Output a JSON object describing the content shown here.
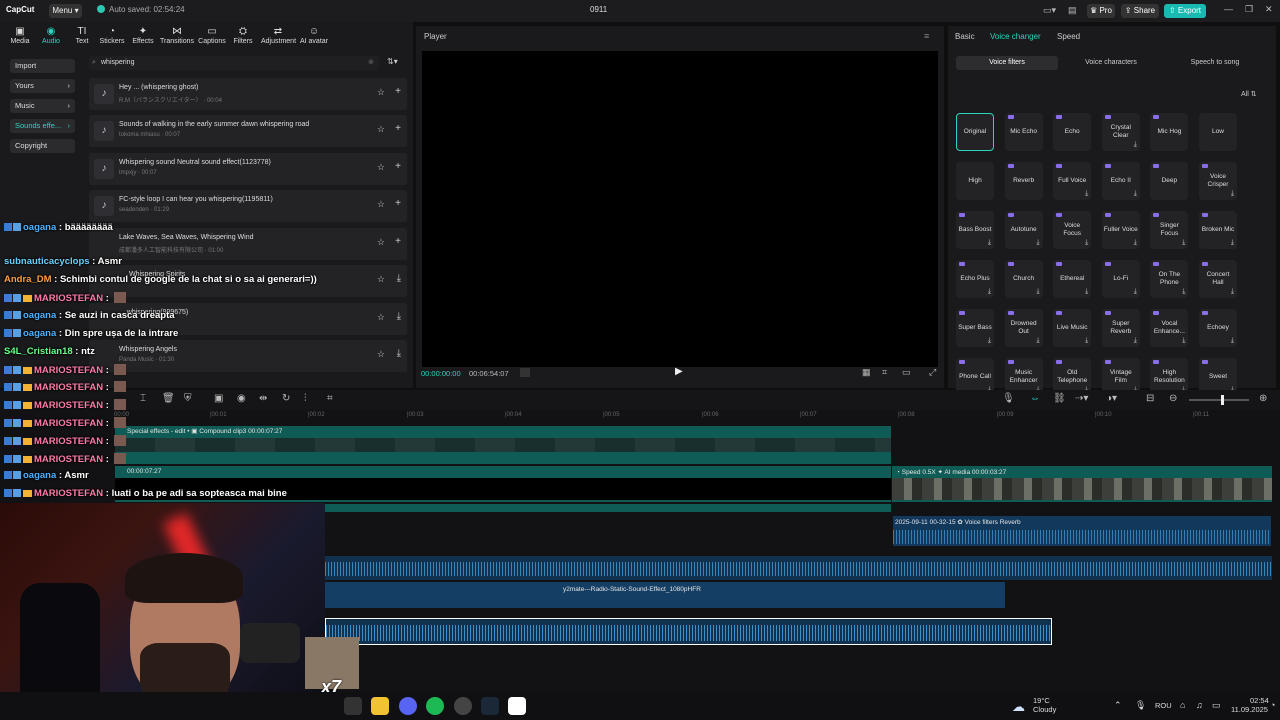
{
  "titlebar": {
    "logo": "CapCut",
    "menu": "Menu",
    "autosave": "Auto saved: 02:54:24",
    "project": "0911",
    "pro": "Pro",
    "share": "Share",
    "export": "Export"
  },
  "toolbar": {
    "items": [
      {
        "label": "Media",
        "icon": "media-icon"
      },
      {
        "label": "Audio",
        "icon": "audio-icon"
      },
      {
        "label": "Text",
        "icon": "text-icon"
      },
      {
        "label": "Stickers",
        "icon": "stickers-icon"
      },
      {
        "label": "Effects",
        "icon": "effects-icon"
      },
      {
        "label": "Transitions",
        "icon": "transitions-icon"
      },
      {
        "label": "Captions",
        "icon": "captions-icon"
      },
      {
        "label": "Filters",
        "icon": "filters-icon"
      },
      {
        "label": "Adjustment",
        "icon": "adjustment-icon"
      },
      {
        "label": "AI avatar",
        "icon": "ai-avatar-icon"
      }
    ]
  },
  "leftnav": {
    "import": "Import",
    "yours": "Yours",
    "music": "Music",
    "sounds": "Sounds effe...",
    "copyright": "Copyright"
  },
  "search": {
    "value": "whispering"
  },
  "tracks": [
    {
      "title": "Hey ... (whispering ghost)",
      "sub": "R.M（バランスクリエイター） · 00:04"
    },
    {
      "title": "Sounds of walking in the early summer dawn whispering road",
      "sub": "tokoma mhiasu · 00:07"
    },
    {
      "title": "Whispering sound Neutral sound effect(1123778)",
      "sub": "tmpxjy · 00:07"
    },
    {
      "title": "FC-style loop I can hear you whispering(1195811)",
      "sub": "seadenden · 01:29"
    },
    {
      "title": "Lake Waves, Sea Waves, Whispering Wind",
      "sub": "成都潘多人工智能科技有限公司 · 01:00"
    },
    {
      "title": "Whispering Spirits",
      "sub": ""
    },
    {
      "title": "... whispering(999675)",
      "sub": ""
    },
    {
      "title": "Whispering Angels",
      "sub": "Panda Music · 01:30"
    }
  ],
  "player": {
    "title": "Player",
    "current": "00:00:00:00",
    "total": "00:06:54:07"
  },
  "rightpanel": {
    "tabs": [
      "Basic",
      "Voice changer",
      "Speed"
    ],
    "subtabs": [
      "Voice filters",
      "Voice characters",
      "Speech to song"
    ],
    "filter_all": "All",
    "filters": [
      "Original",
      "Mic Echo",
      "Echo",
      "Crystal Clear",
      "Mic Hog",
      "Low",
      "High",
      "Reverb",
      "Full Voice",
      "Echo II",
      "Deep",
      "Voice Crisper",
      "Bass Boost",
      "Autotune",
      "Voice Focus",
      "Fuller Voice",
      "Singer Focus",
      "Broken Mic",
      "Echo Plus",
      "Church",
      "Ethereal",
      "Lo-Fi",
      "On The Phone",
      "Concert Hall",
      "Super Bass",
      "Drowned Out",
      "Live Music",
      "Super Reverb",
      "Vocal Enhance...",
      "Echoey",
      "Phone Call",
      "Music Enhancer",
      "Old Telephone",
      "Vintage Film",
      "High Resolution",
      "Sweet"
    ]
  },
  "ruler": [
    "00:00",
    "|00:01",
    "|00:02",
    "|00:03",
    "|00:04",
    "|00:05",
    "|00:06",
    "|00:07",
    "|00:08",
    "|00:09",
    "|00:10",
    "|00:11"
  ],
  "timeline": {
    "clip1": "Special effects - edit •",
    "clip1b": "Compound clip3",
    "clip1c": "00:00:07:27",
    "clip2": "00:00:07:27",
    "clip3": "Speed 0.5X",
    "clip3b": "AI media",
    "clip3c": "00:00:03:27",
    "clip4": "2025-09-11 00-32-15",
    "clip4b": "Voice filters Reverb",
    "clip5": "y2mate---Radio-Static-Sound-Effect_1080pHFR"
  },
  "chat": [
    {
      "user": "oagana",
      "color": "#4fb3ff",
      "msg": "bääääääää",
      "badges": 2
    },
    {
      "user": "subnauticacyclops",
      "color": "#69d2ff",
      "msg": "Asmr",
      "badges": 0
    },
    {
      "user": "Andra_DM",
      "color": "#ff9f43",
      "msg": "Schimbi contul de google de la chat si o sa ai generari=))",
      "badges": 0
    },
    {
      "user": "MARIOSTEFAN",
      "color": "#ff7aa8",
      "msg": "",
      "badges": 3
    },
    {
      "user": "oagana",
      "color": "#4fb3ff",
      "msg": "Se auzi in casca dreapta",
      "badges": 2
    },
    {
      "user": "oagana",
      "color": "#4fb3ff",
      "msg": "Din spre ușa de la intrare",
      "badges": 2
    },
    {
      "user": "S4L_Cristian18",
      "color": "#69ff8a",
      "msg": "ntz",
      "badges": 0
    },
    {
      "user": "MARIOSTEFAN",
      "color": "#ff7aa8",
      "msg": "",
      "badges": 3
    },
    {
      "user": "MARIOSTEFAN",
      "color": "#ff7aa8",
      "msg": "",
      "badges": 3
    },
    {
      "user": "MARIOSTEFAN",
      "color": "#ff7aa8",
      "msg": "",
      "badges": 3
    },
    {
      "user": "MARIOSTEFAN",
      "color": "#ff7aa8",
      "msg": "",
      "badges": 3
    },
    {
      "user": "MARIOSTEFAN",
      "color": "#ff7aa8",
      "msg": "",
      "badges": 3
    },
    {
      "user": "MARIOSTEFAN",
      "color": "#ff7aa8",
      "msg": "",
      "badges": 3
    },
    {
      "user": "oagana",
      "color": "#4fb3ff",
      "msg": "Asmr",
      "badges": 2
    },
    {
      "user": "MARIOSTEFAN",
      "color": "#ff7aa8",
      "msg": "luati o ba pe adi sa sopteasca mai bine",
      "badges": 3
    }
  ],
  "overlay": {
    "x7": "x7"
  },
  "taskbar": {
    "temp": "19°C",
    "weather": "Cloudy",
    "lang": "ROU",
    "time": "02:54",
    "date": "11.09.2025"
  },
  "colors": {
    "accent": "#2cd3c0",
    "export": "#18b9b0"
  }
}
